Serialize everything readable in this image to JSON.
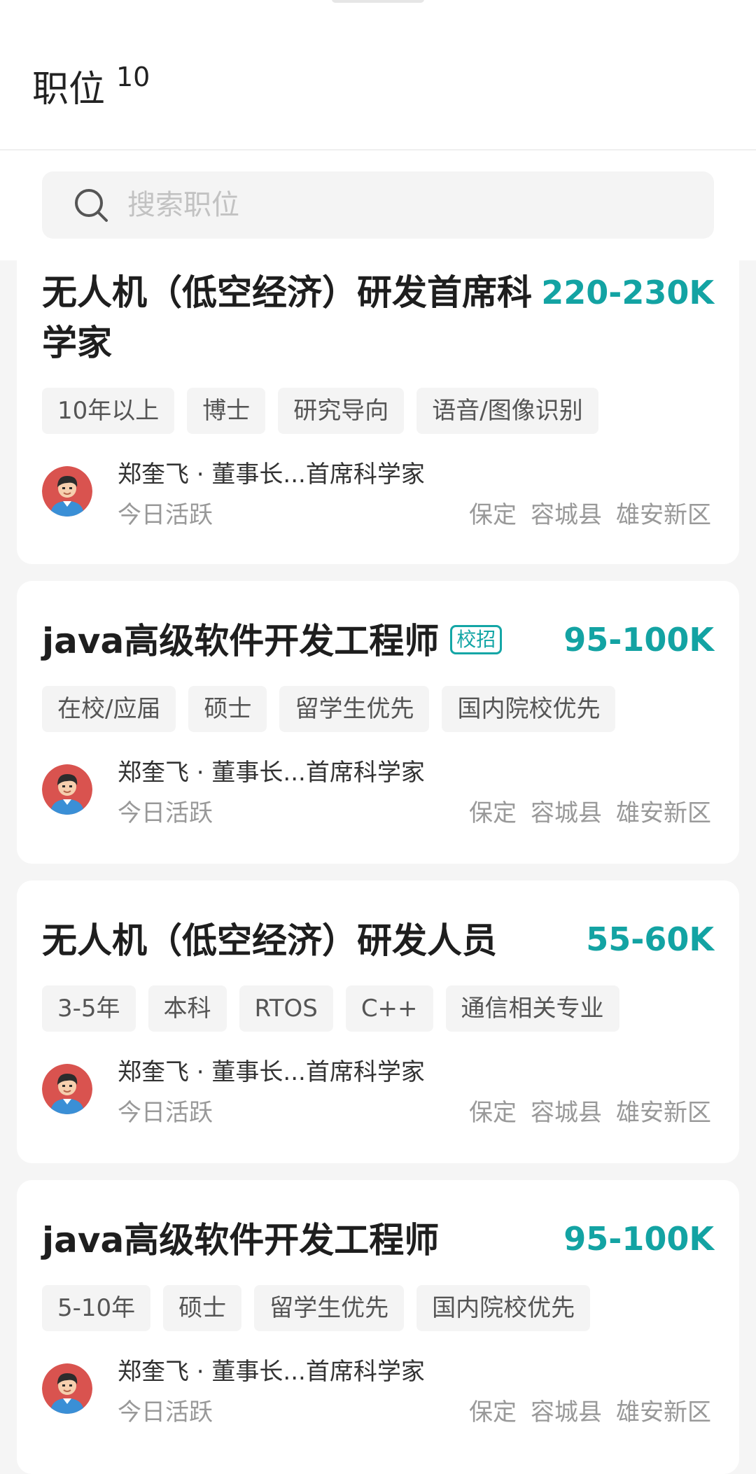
{
  "header": {
    "title": "职位",
    "count": "10"
  },
  "search": {
    "placeholder": "搜索职位"
  },
  "jobs": [
    {
      "title": "无人机（低空经济）研发首席科学家",
      "badge": "",
      "salary": "220-230K",
      "tags": [
        "10年以上",
        "博士",
        "研究导向",
        "语音/图像识别"
      ],
      "recruiter": "郑奎飞 · 董事长...首席科学家",
      "status": "今日活跃",
      "location": [
        "保定",
        "容城县",
        "雄安新区"
      ]
    },
    {
      "title": "java高级软件开发工程师",
      "badge": "校招",
      "salary": "95-100K",
      "tags": [
        "在校/应届",
        "硕士",
        "留学生优先",
        "国内院校优先"
      ],
      "recruiter": "郑奎飞 · 董事长...首席科学家",
      "status": "今日活跃",
      "location": [
        "保定",
        "容城县",
        "雄安新区"
      ]
    },
    {
      "title": "无人机（低空经济）研发人员",
      "badge": "",
      "salary": "55-60K",
      "tags": [
        "3-5年",
        "本科",
        "RTOS",
        "C++",
        "通信相关专业"
      ],
      "recruiter": "郑奎飞 · 董事长...首席科学家",
      "status": "今日活跃",
      "location": [
        "保定",
        "容城县",
        "雄安新区"
      ]
    },
    {
      "title": "java高级软件开发工程师",
      "badge": "",
      "salary": "95-100K",
      "tags": [
        "5-10年",
        "硕士",
        "留学生优先",
        "国内院校优先"
      ],
      "recruiter": "郑奎飞 · 董事长...首席科学家",
      "status": "今日活跃",
      "location": [
        "保定",
        "容城县",
        "雄安新区"
      ]
    }
  ],
  "colors": {
    "accent": "#13a3a3",
    "background": "#f5f5f5",
    "card": "#ffffff",
    "tag_bg": "#f4f4f4",
    "muted_text": "#999999"
  },
  "icons": {
    "search": "search-icon",
    "avatar": "avatar"
  }
}
